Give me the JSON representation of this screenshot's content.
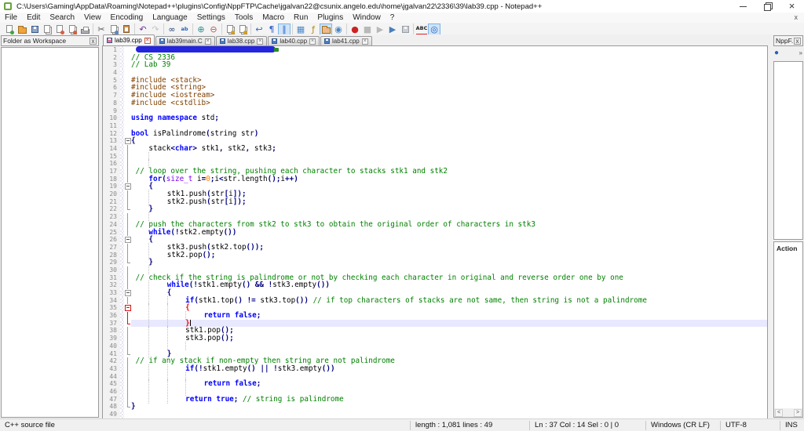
{
  "palette": {
    "comment": "#008000",
    "preproc": "#804000",
    "keyword": "#0000ff",
    "type2": "#8000ff",
    "number": "#ff8000",
    "operator": "#000080",
    "brace_match": "#ff0000",
    "current_line": "#e8e8ff",
    "tab_disk_saved": "#4a7ec8",
    "tab_disk_modified": "#e0709a"
  },
  "window": {
    "title": "C:\\Users\\Gaming\\AppData\\Roaming\\Notepad++\\plugins\\Config\\NppFTP\\Cache\\jgalvan22@csunix.angelo.edu\\home\\jgalvan22\\2336\\39\\lab39.cpp - Notepad++"
  },
  "menus": [
    "File",
    "Edit",
    "Search",
    "View",
    "Encoding",
    "Language",
    "Settings",
    "Tools",
    "Macro",
    "Run",
    "Plugins",
    "Window",
    "?"
  ],
  "menu_close_label": "x",
  "toolbar": [
    [
      {
        "name": "new-file",
        "shape": "page",
        "ac": "#3aa83a"
      },
      {
        "name": "open-file",
        "shape": "folder",
        "ac": "#f0a43c"
      },
      {
        "name": "save-file",
        "shape": "disk",
        "ac": "#8fa6c8"
      },
      {
        "name": "save-all",
        "shape": "pages"
      },
      {
        "name": "close-file",
        "shape": "page",
        "ac": "#e05a3a"
      },
      {
        "name": "close-all",
        "shape": "pages",
        "ac": "#e05a3a"
      },
      {
        "name": "print",
        "shape": "printer"
      }
    ],
    [
      {
        "name": "cut",
        "glyph": "✂",
        "color": "#555555"
      },
      {
        "name": "copy",
        "shape": "pages",
        "ac": "#5b86c5"
      },
      {
        "name": "paste",
        "shape": "clip"
      }
    ],
    [
      {
        "name": "undo",
        "glyph": "↶",
        "color": "#7030a0"
      },
      {
        "name": "redo",
        "glyph": "↷",
        "color": "#9a9aa0",
        "disabled": true
      }
    ],
    [
      {
        "name": "find",
        "glyph": "∞",
        "color": "#1a3e6e"
      },
      {
        "name": "replace",
        "glyph": "ab",
        "color": "#2060c0",
        "small": true
      }
    ],
    [
      {
        "name": "zoom-in",
        "glyph": "⊕",
        "color": "#2a9090"
      },
      {
        "name": "zoom-out",
        "glyph": "⊖",
        "color": "#c05050"
      }
    ],
    [
      {
        "name": "sync-vertical-scroll",
        "shape": "pages",
        "ac": "#d4a017"
      },
      {
        "name": "sync-horizontal-scroll",
        "shape": "pages",
        "ac": "#d4a017"
      }
    ],
    [
      {
        "name": "word-wrap",
        "glyph": "↩",
        "color": "#3366cc"
      },
      {
        "name": "show-all-characters",
        "glyph": "¶",
        "color": "#3366cc"
      },
      {
        "name": "show-indent-guide",
        "glyph": "∥",
        "color": "#3366cc",
        "pressed": true
      }
    ],
    [
      {
        "name": "document-map",
        "glyph": "▦",
        "color": "#4a88c7"
      },
      {
        "name": "function-list",
        "glyph": "ƒ",
        "color": "#b8860b"
      },
      {
        "name": "folder-as-workspace",
        "shape": "folder",
        "ac": "#edb98c",
        "pressed": true
      },
      {
        "name": "document-monitor",
        "glyph": "◉",
        "color": "#4a88c7"
      }
    ],
    [
      {
        "name": "record-macro",
        "glyph": "●",
        "color": "#cc2222"
      },
      {
        "name": "stop-macro",
        "glyph": "■",
        "color": "#8a8a8a",
        "disabled": true
      },
      {
        "name": "play-macro",
        "glyph": "▶",
        "color": "#8a8a8a",
        "disabled": true
      },
      {
        "name": "run-macro-multiple",
        "glyph": "▶",
        "color": "#4a7ebb"
      },
      {
        "name": "save-macro",
        "shape": "disk",
        "ac": "#b0b0b0",
        "disabled": true
      }
    ],
    [
      {
        "name": "spell-check",
        "glyph": "ABC",
        "color": "#222222",
        "small": true,
        "redu": true
      },
      {
        "name": "nppftp-toggle",
        "glyph": "◎",
        "color": "#2060c0",
        "pressed": true
      }
    ]
  ],
  "tabs": [
    {
      "label": "lab39.cpp",
      "active": true,
      "modified": true
    },
    {
      "label": "lab39main.C"
    },
    {
      "label": "lab38.cpp"
    },
    {
      "label": "lab40.cpp"
    },
    {
      "label": "lab41.cpp"
    }
  ],
  "left_panel": {
    "title": "Folder as Workspace",
    "close": "x"
  },
  "right_panel": {
    "title": "NppF...",
    "close": "x",
    "connect_icon": "●",
    "overflow": "»",
    "action_label": "Action",
    "scroll_left": "<",
    "scroll_right": ">"
  },
  "editor": {
    "lines": [
      {
        "n": 1,
        "f": "",
        "red": true
      },
      {
        "n": 2,
        "f": "",
        "s": [
          [
            "// CS 2336",
            "c"
          ]
        ]
      },
      {
        "n": 3,
        "f": "",
        "s": [
          [
            "// Lab 39",
            "c"
          ]
        ]
      },
      {
        "n": 4,
        "f": "",
        "s": []
      },
      {
        "n": 5,
        "f": "",
        "s": [
          [
            "#include <stack>",
            "p"
          ]
        ]
      },
      {
        "n": 6,
        "f": "",
        "s": [
          [
            "#include <string>",
            "p"
          ]
        ]
      },
      {
        "n": 7,
        "f": "",
        "s": [
          [
            "#include <iostream>",
            "p"
          ]
        ]
      },
      {
        "n": 8,
        "f": "",
        "s": [
          [
            "#include <cstdlib>",
            "p"
          ]
        ]
      },
      {
        "n": 9,
        "f": "",
        "s": []
      },
      {
        "n": 10,
        "f": "",
        "s": [
          [
            "using",
            "k"
          ],
          [
            " ",
            "d"
          ],
          [
            "namespace",
            "k"
          ],
          [
            " std",
            "d"
          ],
          [
            ";",
            "o"
          ]
        ]
      },
      {
        "n": 11,
        "f": "",
        "s": []
      },
      {
        "n": 12,
        "f": "",
        "s": [
          [
            "bool",
            "k"
          ],
          [
            " isPalindrome",
            "d"
          ],
          [
            "(",
            "o"
          ],
          [
            "string str",
            "d"
          ],
          [
            ")",
            "o"
          ]
        ]
      },
      {
        "n": 13,
        "f": "o",
        "s": [
          [
            "{",
            "o"
          ]
        ]
      },
      {
        "n": 14,
        "f": "|",
        "s": [
          [
            "    stack",
            "d"
          ],
          [
            "<",
            "o"
          ],
          [
            "char",
            "k"
          ],
          [
            ">",
            "o"
          ],
          [
            " stk1",
            "d"
          ],
          [
            ",",
            "o"
          ],
          [
            " stk2",
            "d"
          ],
          [
            ",",
            "o"
          ],
          [
            " stk3",
            "d"
          ],
          [
            ";",
            "o"
          ]
        ]
      },
      {
        "n": 15,
        "f": "|",
        "s": [
          [
            "        ",
            "d"
          ]
        ]
      },
      {
        "n": 16,
        "f": "|",
        "s": [
          [
            "        ",
            "d"
          ]
        ]
      },
      {
        "n": 17,
        "f": "|",
        "s": [
          [
            " // loop over the string, pushing each character to stacks stk1 and stk2",
            "c"
          ]
        ]
      },
      {
        "n": 18,
        "f": "|",
        "s": [
          [
            "    ",
            "d"
          ],
          [
            "for",
            "k"
          ],
          [
            "(",
            "o"
          ],
          [
            "size_t",
            "t"
          ],
          [
            " i",
            "d"
          ],
          [
            "=",
            "o"
          ],
          [
            "0",
            "n"
          ],
          [
            ";",
            "o"
          ],
          [
            "i",
            "d"
          ],
          [
            "<",
            "o"
          ],
          [
            "str.length",
            "d"
          ],
          [
            "();",
            "o"
          ],
          [
            "i",
            "d"
          ],
          [
            "++)",
            "o"
          ]
        ]
      },
      {
        "n": 19,
        "f": "o",
        "s": [
          [
            "    ",
            "d"
          ],
          [
            "{",
            "o"
          ]
        ]
      },
      {
        "n": 20,
        "f": "|",
        "s": [
          [
            "        stk1.push",
            "d"
          ],
          [
            "(",
            "o"
          ],
          [
            "str",
            "d"
          ],
          [
            "[",
            "o"
          ],
          [
            "i",
            "d"
          ],
          [
            "]);",
            "o"
          ]
        ]
      },
      {
        "n": 21,
        "f": "|",
        "s": [
          [
            "        stk2.push",
            "d"
          ],
          [
            "(",
            "o"
          ],
          [
            "str",
            "d"
          ],
          [
            "[",
            "o"
          ],
          [
            "i",
            "d"
          ],
          [
            "]);",
            "o"
          ]
        ]
      },
      {
        "n": 22,
        "f": "L",
        "s": [
          [
            "    ",
            "d"
          ],
          [
            "}",
            "o"
          ]
        ]
      },
      {
        "n": 23,
        "f": "|",
        "s": [
          [
            "        ",
            "d"
          ]
        ]
      },
      {
        "n": 24,
        "f": "|",
        "s": [
          [
            " // push the characters from stk2 to stk3 to obtain the original order of characters in stk3",
            "c"
          ]
        ]
      },
      {
        "n": 25,
        "f": "|",
        "s": [
          [
            "    ",
            "d"
          ],
          [
            "while",
            "k"
          ],
          [
            "(!",
            "o"
          ],
          [
            "stk2.empty",
            "d"
          ],
          [
            "())",
            "o"
          ]
        ]
      },
      {
        "n": 26,
        "f": "o",
        "s": [
          [
            "    ",
            "d"
          ],
          [
            "{",
            "o"
          ]
        ]
      },
      {
        "n": 27,
        "f": "|",
        "s": [
          [
            "        stk3.push",
            "d"
          ],
          [
            "(",
            "o"
          ],
          [
            "stk2.top",
            "d"
          ],
          [
            "());",
            "o"
          ]
        ]
      },
      {
        "n": 28,
        "f": "|",
        "s": [
          [
            "        stk2.pop",
            "d"
          ],
          [
            "();",
            "o"
          ]
        ]
      },
      {
        "n": 29,
        "f": "L",
        "s": [
          [
            "    ",
            "d"
          ],
          [
            "}",
            "o"
          ]
        ]
      },
      {
        "n": 30,
        "f": "|",
        "s": [
          [
            "        ",
            "d"
          ]
        ]
      },
      {
        "n": 31,
        "f": "|",
        "s": [
          [
            " // check if the string is palindrome or not by checking each character in original and reverse order one by one",
            "c"
          ]
        ]
      },
      {
        "n": 32,
        "f": "|",
        "s": [
          [
            "        ",
            "d"
          ],
          [
            "while",
            "k"
          ],
          [
            "(!",
            "o"
          ],
          [
            "stk1.empty",
            "d"
          ],
          [
            "()",
            "o"
          ],
          [
            " ",
            "d"
          ],
          [
            "&&",
            "o"
          ],
          [
            " !",
            "o"
          ],
          [
            "stk3.empty",
            "d"
          ],
          [
            "())",
            "o"
          ]
        ]
      },
      {
        "n": 33,
        "f": "o",
        "s": [
          [
            "        ",
            "d"
          ],
          [
            "{",
            "o"
          ]
        ]
      },
      {
        "n": 34,
        "f": "|",
        "s": [
          [
            "            ",
            "d"
          ],
          [
            "if",
            "k"
          ],
          [
            "(",
            "o"
          ],
          [
            "stk1.top",
            "d"
          ],
          [
            "()",
            "o"
          ],
          [
            " ",
            "d"
          ],
          [
            "!=",
            "o"
          ],
          [
            " ",
            "d"
          ],
          [
            "stk3.top",
            "d"
          ],
          [
            "())",
            "o"
          ],
          [
            " // if top characters of stacks are not same, then string is not a palindrome",
            "c"
          ]
        ]
      },
      {
        "n": 35,
        "f": "ro",
        "s": [
          [
            "            ",
            "d"
          ],
          [
            "{",
            "r"
          ]
        ]
      },
      {
        "n": 36,
        "f": "r|",
        "s": [
          [
            "                ",
            "d"
          ],
          [
            "return",
            "k"
          ],
          [
            " ",
            "d"
          ],
          [
            "false",
            "k"
          ],
          [
            ";",
            "o"
          ]
        ]
      },
      {
        "n": 37,
        "f": "rL",
        "cur": true,
        "caret": true,
        "s": [
          [
            "            ",
            "d"
          ],
          [
            "}",
            "r"
          ]
        ]
      },
      {
        "n": 38,
        "f": "|",
        "s": [
          [
            "            stk1.pop",
            "d"
          ],
          [
            "();",
            "o"
          ]
        ]
      },
      {
        "n": 39,
        "f": "|",
        "s": [
          [
            "            stk3.pop",
            "d"
          ],
          [
            "();",
            "o"
          ]
        ]
      },
      {
        "n": 40,
        "f": "|",
        "s": [
          [
            "                ",
            "d"
          ]
        ]
      },
      {
        "n": 41,
        "f": "L",
        "s": [
          [
            "        ",
            "d"
          ],
          [
            "}",
            "o"
          ]
        ]
      },
      {
        "n": 42,
        "f": "|",
        "s": [
          [
            " // if any stack if non-empty then string are not palindrome",
            "c"
          ]
        ]
      },
      {
        "n": 43,
        "f": "|",
        "s": [
          [
            "            ",
            "d"
          ],
          [
            "if",
            "k"
          ],
          [
            "(!",
            "o"
          ],
          [
            "stk1.empty",
            "d"
          ],
          [
            "()",
            "o"
          ],
          [
            " ",
            "d"
          ],
          [
            "||",
            "o"
          ],
          [
            " !",
            "o"
          ],
          [
            "stk3.empty",
            "d"
          ],
          [
            "())",
            "o"
          ]
        ]
      },
      {
        "n": 44,
        "f": "|",
        "s": [
          [
            "                ",
            "d"
          ]
        ]
      },
      {
        "n": 45,
        "f": "|",
        "s": [
          [
            "                ",
            "d"
          ],
          [
            "return",
            "k"
          ],
          [
            " ",
            "d"
          ],
          [
            "false",
            "k"
          ],
          [
            ";",
            "o"
          ]
        ]
      },
      {
        "n": 46,
        "f": "|",
        "s": [
          [
            "                ",
            "d"
          ]
        ]
      },
      {
        "n": 47,
        "f": "|",
        "s": [
          [
            "            ",
            "d"
          ],
          [
            "return",
            "k"
          ],
          [
            " ",
            "d"
          ],
          [
            "true",
            "k"
          ],
          [
            ";",
            "o"
          ],
          [
            " // string is palindrome",
            "c"
          ]
        ]
      },
      {
        "n": 48,
        "f": "L",
        "s": [
          [
            "}",
            "o"
          ]
        ]
      },
      {
        "n": 49,
        "f": "",
        "s": []
      }
    ]
  },
  "status_bar": {
    "doc_type": "C++ source file",
    "length_lines": "length : 1,081    lines : 49",
    "position": "Ln : 37    Col : 14    Sel : 0 | 0",
    "eol": "Windows (CR LF)",
    "encoding": "UTF-8",
    "mode": "INS"
  }
}
